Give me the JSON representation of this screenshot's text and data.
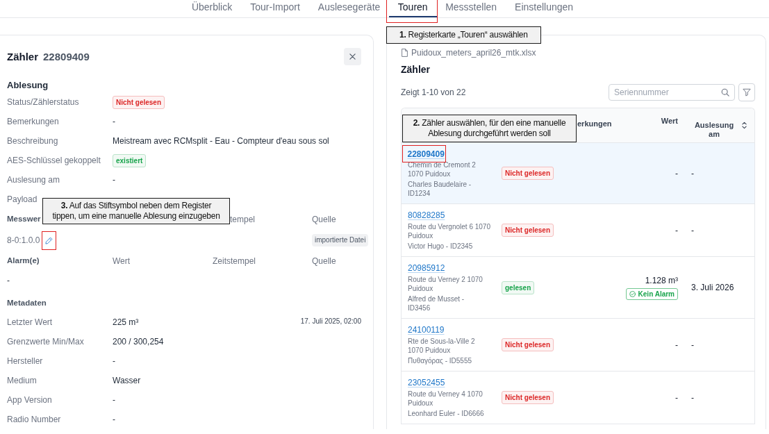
{
  "nav": {
    "tabs": [
      {
        "label": "Überblick",
        "selected": false,
        "highlighted": false
      },
      {
        "label": "Tour-Import",
        "selected": false,
        "highlighted": false
      },
      {
        "label": "Auslesegeräte",
        "selected": false,
        "highlighted": false
      },
      {
        "label": "Touren",
        "selected": true,
        "highlighted": true
      },
      {
        "label": "Messstellen",
        "selected": false,
        "highlighted": false
      },
      {
        "label": "Einstellungen",
        "selected": false,
        "highlighted": false
      }
    ],
    "callout": "**1.** Registerkarte „Touren“ auswählen"
  },
  "meter_panel": {
    "title": "Zähler",
    "serial": "22809409",
    "reading": {
      "title": "Ablesung",
      "rows": [
        {
          "label": "Status/Zählerstatus",
          "kind": "badge",
          "value": "Nicht gelesen",
          "color": "#dc2626"
        },
        {
          "label": "Bemerkungen",
          "kind": "text",
          "value": "-"
        },
        {
          "label": "Beschreibung",
          "kind": "text",
          "value": "Meistream avec RCMsplit - Eau - Compteur d'eau sous sol"
        },
        {
          "label": "AES-Schlüssel gekoppelt",
          "kind": "badge",
          "value": "existiert",
          "color": "#16a34a"
        },
        {
          "label": "Auslesung am",
          "kind": "text",
          "value": "-"
        },
        {
          "label": "Payload",
          "kind": "text"
        }
      ]
    },
    "measurements": {
      "title": "Messwer",
      "columns": [
        {
          "kind": "time",
          "label": "tempel"
        },
        {
          "kind": "source",
          "label": "Quelle"
        }
      ],
      "registers": [
        {
          "name": "8-0:1.0.0",
          "highlighted": true,
          "source": "importierte Datei"
        }
      ],
      "callout": "**3.** Auf das Stiftsymbol neben dem Register\ntippen, um eine manuelle Ablesung einzugeben"
    },
    "alarms": {
      "title": "Alarm(e)",
      "columns": [
        {
          "kind": "value",
          "label": "Wert"
        },
        {
          "kind": "time",
          "label": "Zeitstempel"
        },
        {
          "kind": "source",
          "label": "Quelle"
        }
      ],
      "empty": "-"
    },
    "metadata": {
      "title": "Metadaten",
      "rows": [
        {
          "label": "Letzter Wert",
          "value": "225 m³",
          "timestamp": "17. Juli 2025, 02:00"
        },
        {
          "label": "Grenzwerte Min/Max",
          "value": "200 / 300,254"
        },
        {
          "label": "Hersteller",
          "value": "-"
        },
        {
          "label": "Medium",
          "value": "Wasser"
        },
        {
          "label": "App Version",
          "value": "-"
        },
        {
          "label": "Radio Number",
          "value": "-"
        }
      ]
    }
  },
  "tour_panel": {
    "file": "Puidoux_meters_april26_mtk.xlsx",
    "title": "Zähler",
    "count": "Zeigt 1-10 von 22",
    "search": {
      "placeholder": "Seriennummer"
    },
    "table": {
      "columns": [
        {
          "kind": "remarks",
          "label": "erkungen"
        },
        {
          "kind": "value",
          "label": "Wert"
        },
        {
          "kind": "date",
          "label": "Auslesung am",
          "sortable": true
        }
      ],
      "callout": "**2.** Zähler auswählen, für den eine manuelle\nAblesung durchgeführt werden soll",
      "rows": [
        {
          "serial": "22809409",
          "selected": true,
          "highlighted": true,
          "address": "Chemin de Cremont 2\n1070 Puidoux",
          "customer": "Charles Baudelaire -\nID1234",
          "status": {
            "label": "Nicht gelesen",
            "color": "#dc2626"
          },
          "value": "-",
          "read_at": "-"
        },
        {
          "serial": "80828285",
          "selected": false,
          "highlighted": false,
          "address": "Route du Vergnolet 6 1070\nPuidoux",
          "customer": "Victor Hugo - ID2345",
          "status": {
            "label": "Nicht gelesen",
            "color": "#dc2626"
          },
          "value": "-",
          "read_at": "-"
        },
        {
          "serial": "20985912",
          "selected": false,
          "highlighted": false,
          "address": "Route du Verney 2 1070\nPuidoux",
          "customer": "Alfred de Musset -\nID3456",
          "status": {
            "label": "gelesen",
            "color": "#16a34a"
          },
          "value": "1.128 m³",
          "alarm": {
            "label": "Kein Alarm",
            "color": "#16a34a"
          },
          "read_at": "3. Juli 2026"
        },
        {
          "serial": "24100119",
          "selected": false,
          "highlighted": false,
          "address": "Rte de Sous-la-Ville 2\n1070 Puidoux",
          "customer": "Πυθαγόρας - ID5555",
          "status": {
            "label": "Nicht gelesen",
            "color": "#dc2626"
          },
          "value": "-",
          "read_at": "-"
        },
        {
          "serial": "23052455",
          "selected": false,
          "highlighted": false,
          "address": "Route du Verney 4 1070\nPuidoux",
          "customer": "Leonhard Euler - ID6666",
          "status": {
            "label": "Nicht gelesen",
            "color": "#dc2626"
          },
          "value": "-",
          "read_at": "-"
        }
      ]
    }
  }
}
